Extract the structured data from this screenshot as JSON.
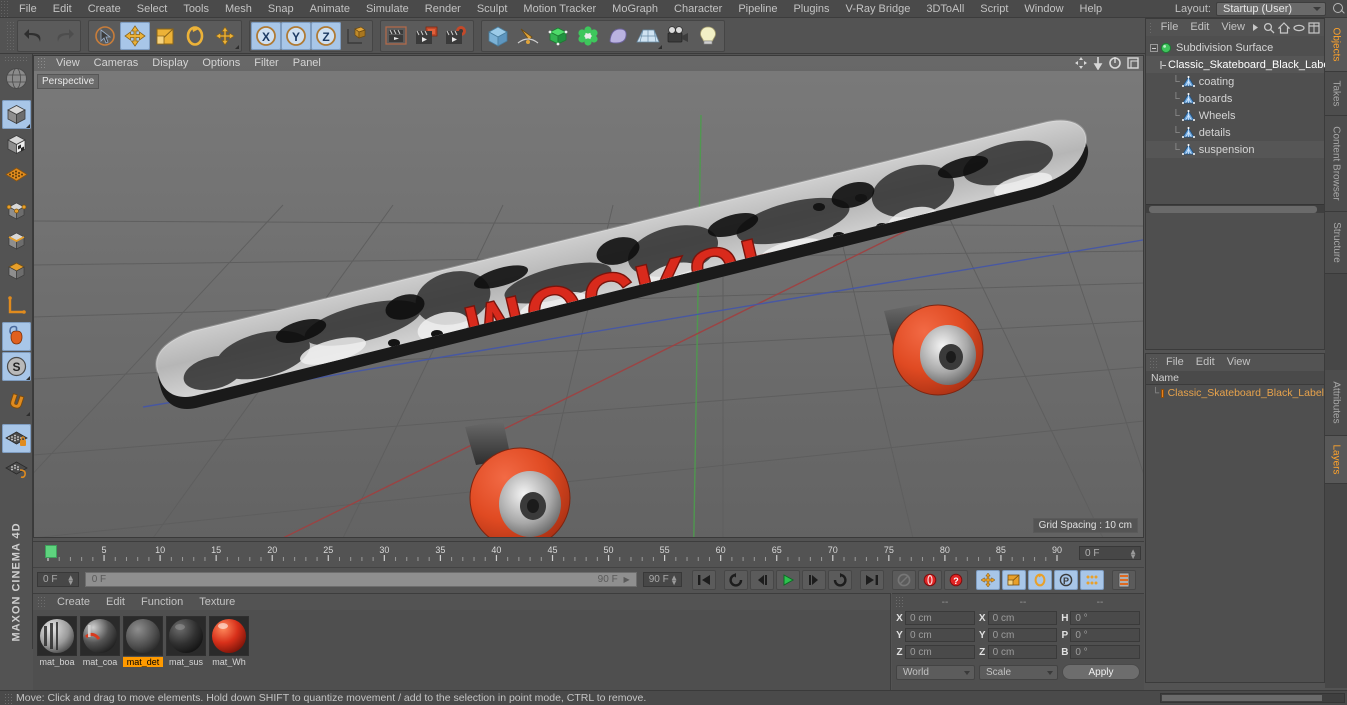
{
  "menubar": {
    "items": [
      "File",
      "Edit",
      "Create",
      "Select",
      "Tools",
      "Mesh",
      "Snap",
      "Animate",
      "Simulate",
      "Render",
      "Sculpt",
      "Motion Tracker",
      "MoGraph",
      "Character",
      "Pipeline",
      "Plugins",
      "V-Ray Bridge",
      "3DToAll",
      "Script",
      "Window",
      "Help"
    ],
    "layout_label": "Layout:",
    "layout_value": "Startup (User)",
    "search_icon": "magnifier-icon"
  },
  "toolbar": {
    "groups": [
      {
        "name": "undo-redo",
        "buttons": [
          {
            "name": "undo-button",
            "icon": "undo-arrow-icon",
            "selected": false
          },
          {
            "name": "redo-button",
            "icon": "redo-arrow-icon",
            "selected": false,
            "disabled": true
          }
        ]
      },
      {
        "name": "transform-tools",
        "buttons": [
          {
            "name": "live-selection-tool",
            "icon": "cursor-circle-icon",
            "selected": false
          },
          {
            "name": "move-tool",
            "icon": "move-arrows-icon",
            "selected": true
          },
          {
            "name": "scale-tool",
            "icon": "scale-square-icon",
            "selected": false
          },
          {
            "name": "rotate-tool",
            "icon": "rotate-ring-icon",
            "selected": false
          },
          {
            "name": "move-alt-tool",
            "icon": "move-arrows-icon",
            "selected": false
          }
        ]
      },
      {
        "name": "axis-locks",
        "buttons": [
          {
            "name": "lock-x-axis",
            "icon": "x-axis-icon",
            "selected": true
          },
          {
            "name": "lock-y-axis",
            "icon": "y-axis-icon",
            "selected": true
          },
          {
            "name": "lock-z-axis",
            "icon": "z-axis-icon",
            "selected": true
          },
          {
            "name": "world-object-coordinate-toggle",
            "icon": "world-axis-cube-icon",
            "selected": false
          }
        ]
      },
      {
        "name": "render-group",
        "buttons": [
          {
            "name": "render-view-button",
            "icon": "render-clapper-icon",
            "selected": false
          },
          {
            "name": "render-to-picture-viewer-button",
            "icon": "render-picture-icon",
            "selected": false
          },
          {
            "name": "render-settings-button",
            "icon": "render-settings-icon",
            "selected": false
          }
        ]
      },
      {
        "name": "create-group",
        "buttons": [
          {
            "name": "add-cube-button",
            "icon": "cube-icon",
            "selected": false
          },
          {
            "name": "add-spline-button",
            "icon": "pen-spline-icon",
            "selected": false
          },
          {
            "name": "add-nurbs-button",
            "icon": "green-cube-icon",
            "selected": false
          },
          {
            "name": "add-array-button",
            "icon": "green-cluster-icon",
            "selected": false
          },
          {
            "name": "add-deformer-button",
            "icon": "bend-deformer-icon",
            "selected": false
          },
          {
            "name": "add-floor-button",
            "icon": "floor-grid-icon",
            "selected": false
          },
          {
            "name": "add-camera-button",
            "icon": "camera-icon",
            "selected": false
          },
          {
            "name": "add-light-button",
            "icon": "lightbulb-icon",
            "selected": false
          }
        ]
      }
    ]
  },
  "left_toolbar": {
    "buttons": [
      {
        "name": "undo-view-button",
        "icon": "globe-wire-icon",
        "selected": false
      },
      {
        "name": "model-mode-button",
        "icon": "model-cube-icon",
        "selected": true
      },
      {
        "name": "texture-mode-button",
        "icon": "texture-cube-icon",
        "selected": false
      },
      {
        "name": "workplane-mode-button",
        "icon": "orange-grid-icon",
        "selected": false
      },
      {
        "name": "points-mode-button",
        "icon": "points-cube-icon",
        "selected": false
      },
      {
        "name": "edges-mode-button",
        "icon": "edges-cube-icon",
        "selected": false
      },
      {
        "name": "polygons-mode-button",
        "icon": "polygons-cube-icon",
        "selected": false
      },
      {
        "name": "axis-mode-button",
        "icon": "axis-l-icon",
        "selected": false
      },
      {
        "name": "enable-axis-button",
        "icon": "mouse-axis-icon",
        "selected": true
      },
      {
        "name": "soft-selection-button",
        "icon": "s-circle-icon",
        "selected": true
      },
      {
        "name": "magnet-button",
        "icon": "magnet-icon",
        "selected": false
      },
      {
        "name": "lock-workplane-button",
        "icon": "grid-lock-icon",
        "selected": true
      },
      {
        "name": "workplane-snap-button",
        "icon": "grid-snap-icon",
        "selected": false
      }
    ],
    "brand": "MAXON CINEMA 4D"
  },
  "viewport": {
    "menus": [
      "View",
      "Cameras",
      "Display",
      "Options",
      "Filter",
      "Panel"
    ],
    "nav_icons": [
      "pan-icon",
      "dolly-icon",
      "orbit-icon",
      "maximize-icon"
    ],
    "camera_label": "Perspective",
    "grid_label": "Grid Spacing : 10 cm",
    "scene": {
      "object": "Classic Skateboard (Black Label)",
      "deck_text": "MOCKUP",
      "deck_text_color": "#d92a1c",
      "wheel_color": "#dd4022",
      "axis_gizmo": {
        "x": "#d23b3b",
        "y": "#5ec85e",
        "z": "#4a6ed8"
      }
    }
  },
  "timeline": {
    "ticks": [
      0,
      5,
      10,
      15,
      20,
      25,
      30,
      35,
      40,
      45,
      50,
      55,
      60,
      65,
      70,
      75,
      80,
      85,
      90
    ],
    "current_frame_field": "0 F",
    "playhead_frame": 0
  },
  "transport": {
    "start_field": "0 F",
    "slider_left_value": "0 F",
    "slider_right_value": "90 F",
    "end_field": "90 F",
    "buttons": [
      {
        "name": "go-to-start-button",
        "icon": "skip-start-icon"
      },
      {
        "name": "loop-back-button",
        "icon": "loop-back-icon"
      },
      {
        "name": "step-back-button",
        "icon": "step-back-icon"
      },
      {
        "name": "play-button",
        "icon": "play-icon"
      },
      {
        "name": "step-forward-button",
        "icon": "step-forward-icon"
      },
      {
        "name": "loop-forward-button",
        "icon": "loop-forward-icon"
      },
      {
        "name": "go-to-end-button",
        "icon": "skip-end-icon"
      },
      {
        "name": "autokeying-button",
        "icon": "autokey-circle-icon"
      },
      {
        "name": "record-active-objects-button",
        "icon": "record-circle-icon"
      },
      {
        "name": "keyframe-selection-button",
        "icon": "question-circle-icon"
      },
      {
        "name": "record-position-button",
        "icon": "move-arrows-icon"
      },
      {
        "name": "record-scale-button",
        "icon": "scale-square-icon"
      },
      {
        "name": "record-rotation-button",
        "icon": "rotate-ring-icon"
      },
      {
        "name": "record-parameter-button",
        "icon": "p-circle-icon"
      },
      {
        "name": "record-pla-button",
        "icon": "point-level-anim-icon"
      },
      {
        "name": "timeline-toggle-button",
        "icon": "timeline-bars-icon"
      }
    ]
  },
  "material_manager": {
    "menus": [
      "Create",
      "Edit",
      "Function",
      "Texture"
    ],
    "materials": [
      {
        "name": "mat_boa",
        "selected": false,
        "preview": "striped-metal"
      },
      {
        "name": "mat_coa",
        "selected": false,
        "preview": "red-black-gloss"
      },
      {
        "name": "mat_det",
        "selected": true,
        "preview": "dark-grey-matte"
      },
      {
        "name": "mat_sus",
        "selected": false,
        "preview": "black-gloss"
      },
      {
        "name": "mat_Wh",
        "selected": false,
        "preview": "red-gloss"
      }
    ]
  },
  "coordinates": {
    "headers": [
      "--",
      "--",
      "--"
    ],
    "rows": [
      {
        "axis1": "X",
        "pos": "0 cm",
        "axis2": "X",
        "size": "0 cm",
        "axis3": "H",
        "rot": "0 °"
      },
      {
        "axis1": "Y",
        "pos": "0 cm",
        "axis2": "Y",
        "size": "0 cm",
        "axis3": "P",
        "rot": "0 °"
      },
      {
        "axis1": "Z",
        "pos": "0 cm",
        "axis2": "Z",
        "size": "0 cm",
        "axis3": "B",
        "rot": "0 °"
      }
    ],
    "space_select": "World",
    "mode_select": "Scale",
    "apply_label": "Apply"
  },
  "object_manager": {
    "menus": [
      "File",
      "Edit",
      "View"
    ],
    "header_icons": [
      "chevron-right-icon",
      "search-icon",
      "home-icon",
      "ellipse-icon",
      "layout-icon"
    ],
    "tree": [
      {
        "label": "Subdivision Surface",
        "depth": 0,
        "icon": "subdivision-surface-icon",
        "selected": false
      },
      {
        "label": "Classic_Skateboard_Black_Label",
        "depth": 1,
        "icon": "layer-zero-icon",
        "selected": true
      },
      {
        "label": "coating",
        "depth": 2,
        "icon": "polygon-object-icon",
        "selected": false
      },
      {
        "label": "boards",
        "depth": 2,
        "icon": "polygon-object-icon",
        "selected": false
      },
      {
        "label": "Wheels",
        "depth": 2,
        "icon": "polygon-object-icon",
        "selected": false
      },
      {
        "label": "details",
        "depth": 2,
        "icon": "polygon-object-icon",
        "selected": false
      },
      {
        "label": "suspension",
        "depth": 2,
        "icon": "polygon-object-icon",
        "selected": false
      }
    ]
  },
  "attributes_panel": {
    "menus": [
      "File",
      "Edit",
      "View"
    ],
    "column_header": "Name",
    "rows": [
      {
        "label": "Classic_Skateboard_Black_Label",
        "color": "#e8821e",
        "selected": true
      }
    ]
  },
  "right_tabs": [
    {
      "label": "Objects",
      "active": true
    },
    {
      "label": "Takes",
      "active": false
    },
    {
      "label": "Content Browser",
      "active": false
    },
    {
      "label": "Structure",
      "active": false
    }
  ],
  "right_tabs_lower": [
    {
      "label": "Attributes",
      "active": false
    },
    {
      "label": "Layers",
      "active": true
    }
  ],
  "statusbar": {
    "message": "Move: Click and drag to move elements. Hold down SHIFT to quantize movement / add to the selection in point mode, CTRL to remove."
  },
  "colors": {
    "chrome": "#535353",
    "panel": "#4f4f4f",
    "viewport_bg": "#6f6f6f",
    "accent_blue": "#a8c6e8",
    "accent_orange": "#ff9a00",
    "text": "#c3c3c3"
  }
}
